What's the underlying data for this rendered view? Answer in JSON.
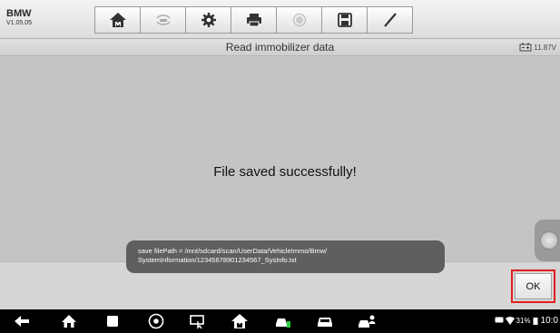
{
  "app": {
    "make": "BMW",
    "version": "V1.05.05"
  },
  "toolbar": {
    "tools": [
      "home-icon",
      "vehicle-swap-icon",
      "settings-icon",
      "print-icon",
      "help-icon",
      "save-icon",
      "edit-icon"
    ]
  },
  "titlebar": {
    "title": "Read immobilizer data",
    "voltage": "11.87V"
  },
  "main": {
    "message": "File saved successfully!"
  },
  "toast": {
    "line1": "save filePath = /mnt/sdcard/scan/UserData/VehicleImmo/Bmw/",
    "line2": "SystemInformation/12345678901234567_SysInfo.txt"
  },
  "footer": {
    "ok_label": "OK"
  },
  "status": {
    "battery": "31%",
    "time": "10:0"
  },
  "colors": {
    "highlight": "#e02020",
    "toast_bg": "#5f5f5f"
  }
}
